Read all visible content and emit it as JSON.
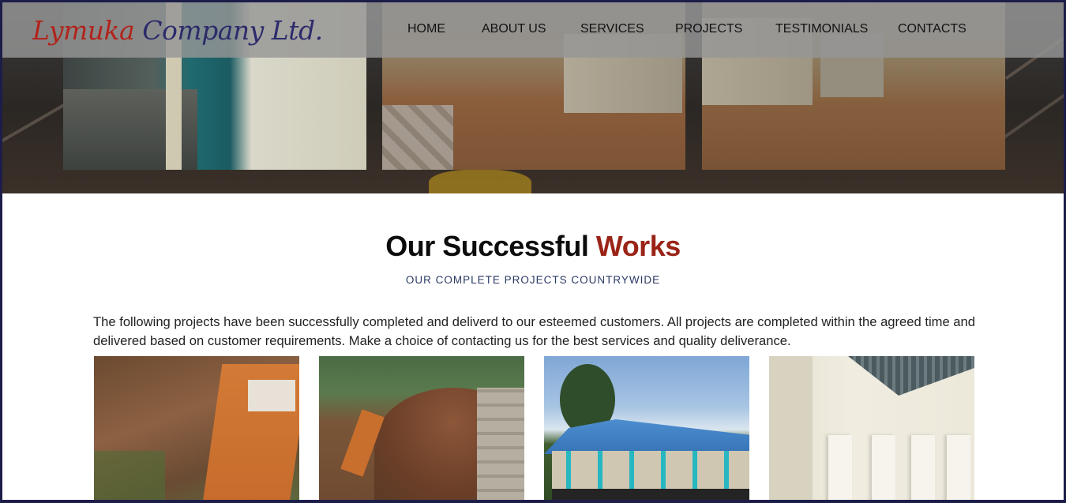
{
  "header": {
    "logo": {
      "part1": "Lymuka",
      "part2": "Company Ltd."
    },
    "nav": [
      {
        "label": "HOME"
      },
      {
        "label": "ABOUT US"
      },
      {
        "label": "SERVICES"
      },
      {
        "label": "PROJECTS"
      },
      {
        "label": "TESTIMONIALS"
      },
      {
        "label": "CONTACTS"
      }
    ]
  },
  "section": {
    "title_main": "Our Successful",
    "title_accent": "Works",
    "subtitle": "OUR COMPLETE PROJECTS COUNTRYWIDE",
    "intro": "The following projects have been successfully completed and deliverd to our esteemed customers. All projects are completed within the agreed time and delivered based on customer requirements. Make a choice of contacting us for the best services and quality deliverance."
  },
  "colors": {
    "accent_red": "#9a2418",
    "logo_red": "#b0241c",
    "logo_navy": "#2d2b6b",
    "subtitle_navy": "#2b3a66"
  }
}
